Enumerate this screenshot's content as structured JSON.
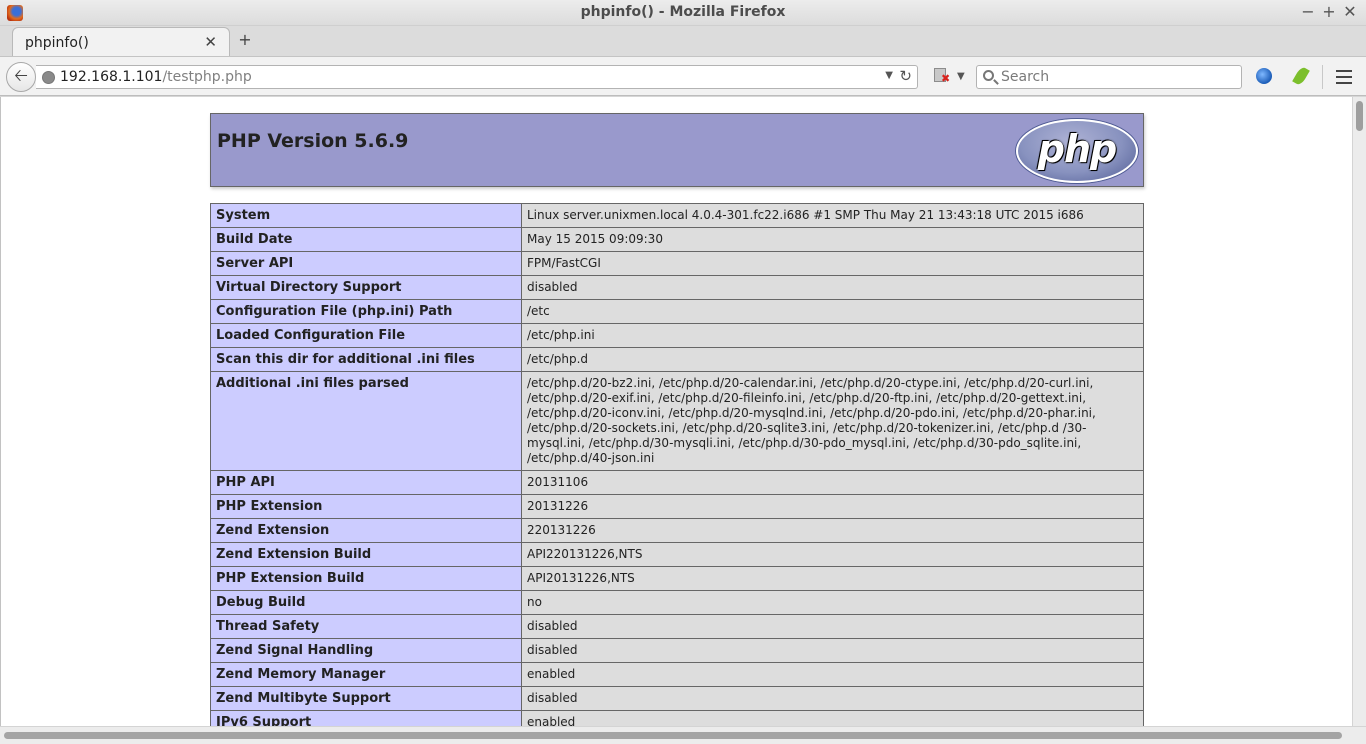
{
  "window": {
    "title": "phpinfo() - Mozilla Firefox"
  },
  "tabs": [
    {
      "label": "phpinfo()",
      "active": true
    }
  ],
  "navbar": {
    "url_host": "192.168.1.101",
    "url_path": "/testphp.php",
    "search_placeholder": "Search"
  },
  "icons": {
    "app": "firefox-icon",
    "back": "back-arrow-icon",
    "site": "globe-icon",
    "reload": "reload-icon",
    "search": "search-icon",
    "menu": "hamburger-menu-icon"
  },
  "page": {
    "version_title": "PHP Version 5.6.9",
    "logo_text": "php",
    "rows": [
      {
        "key": "System",
        "value": "Linux server.unixmen.local 4.0.4-301.fc22.i686 #1 SMP Thu May 21 13:43:18 UTC 2015 i686"
      },
      {
        "key": "Build Date",
        "value": "May 15 2015 09:09:30"
      },
      {
        "key": "Server API",
        "value": "FPM/FastCGI"
      },
      {
        "key": "Virtual Directory Support",
        "value": "disabled"
      },
      {
        "key": "Configuration File (php.ini) Path",
        "value": "/etc"
      },
      {
        "key": "Loaded Configuration File",
        "value": "/etc/php.ini"
      },
      {
        "key": "Scan this dir for additional .ini files",
        "value": "/etc/php.d"
      },
      {
        "key": "Additional .ini files parsed",
        "value": "/etc/php.d/20-bz2.ini, /etc/php.d/20-calendar.ini, /etc/php.d/20-ctype.ini, /etc/php.d/20-curl.ini, /etc/php.d/20-exif.ini, /etc/php.d/20-fileinfo.ini, /etc/php.d/20-ftp.ini, /etc/php.d/20-gettext.ini, /etc/php.d/20-iconv.ini, /etc/php.d/20-mysqlnd.ini, /etc/php.d/20-pdo.ini, /etc/php.d/20-phar.ini, /etc/php.d/20-sockets.ini, /etc/php.d/20-sqlite3.ini, /etc/php.d/20-tokenizer.ini, /etc/php.d /30-mysql.ini, /etc/php.d/30-mysqli.ini, /etc/php.d/30-pdo_mysql.ini, /etc/php.d/30-pdo_sqlite.ini, /etc/php.d/40-json.ini"
      },
      {
        "key": "PHP API",
        "value": "20131106"
      },
      {
        "key": "PHP Extension",
        "value": "20131226"
      },
      {
        "key": "Zend Extension",
        "value": "220131226"
      },
      {
        "key": "Zend Extension Build",
        "value": "API220131226,NTS"
      },
      {
        "key": "PHP Extension Build",
        "value": "API20131226,NTS"
      },
      {
        "key": "Debug Build",
        "value": "no"
      },
      {
        "key": "Thread Safety",
        "value": "disabled"
      },
      {
        "key": "Zend Signal Handling",
        "value": "disabled"
      },
      {
        "key": "Zend Memory Manager",
        "value": "enabled"
      },
      {
        "key": "Zend Multibyte Support",
        "value": "disabled"
      },
      {
        "key": "IPv6 Support",
        "value": "enabled"
      }
    ]
  }
}
